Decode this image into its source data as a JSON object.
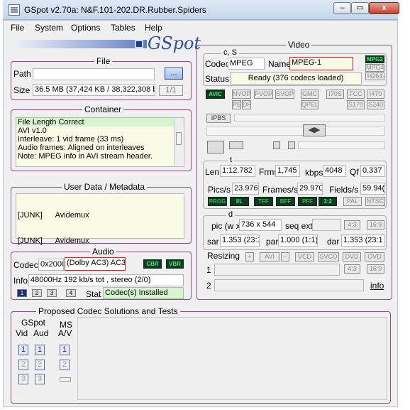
{
  "window": {
    "title": "GSpot v2.70a: N&F.101-202.DR.Rubber.Spiders",
    "min": "–",
    "max": "▭",
    "close": "x"
  },
  "menu": [
    "File",
    "System",
    "Options",
    "Tables",
    "Help"
  ],
  "logo": "GSpot",
  "file": {
    "legend": "File",
    "path_label": "Path",
    "path_value": "",
    "browse": "...",
    "size_label": "Size",
    "size_value": "36.5 MB (37,424 KB / 38,322,308 b",
    "counter": "1/1"
  },
  "container": {
    "legend": "Container",
    "lines": [
      "File Length Correct",
      "AVI v1.0",
      "Interleave: 1 vid frame (33 ms)",
      "Audio frames: Aligned on interleaves",
      "Note: MPEG info in AVI stream header."
    ]
  },
  "userdata": {
    "legend": "User Data / Metadata",
    "lines": [
      "[JUNK]      Avidemux",
      "[JUNK]      Avidemux"
    ]
  },
  "audio": {
    "legend": "Audio",
    "codec_label": "Codec",
    "codec_id": "0x2000",
    "codec_name": "(Dolby AC3) AC3",
    "cbr": "CBR",
    "vbr": "VBR",
    "info_label": "Info",
    "info_value": "48000Hz  192 kb/s tot , stereo (2/0)",
    "streams": [
      "1",
      "2",
      "3",
      "4"
    ],
    "stat_label": "Stat",
    "stat_value": "Codec(s) Installed"
  },
  "proposed": {
    "legend": "Proposed Codec Solutions and Tests",
    "gspot_label": "GSpot",
    "ms_label": "MS",
    "vid": "Vid",
    "aud": "Aud",
    "av": "A/V",
    "nums": [
      "1",
      "2",
      "3"
    ]
  },
  "video": {
    "legend": "Video",
    "cs": {
      "legend": "c, S",
      "codec_label": "Codec",
      "codec_value": "MPEG",
      "name_label": "Name",
      "name_value": "MPEG-1",
      "status_label": "Status",
      "status_value": "Ready (376 codecs loaded)",
      "side": [
        "MPG2",
        "MPG4",
        "H264"
      ]
    },
    "flags_row1": [
      "AVIC",
      "NVOP",
      "PVOP",
      "SVOP",
      "GMC",
      "I70S",
      "FCC",
      "I470"
    ],
    "flags_row2": [
      "PE",
      "DF",
      "QPEL",
      "S170",
      "S240"
    ],
    "ipbs": "IPBS",
    "t": {
      "legend": "t",
      "len_label": "Len",
      "len_value": "1:12.782",
      "frms_label": "Frms",
      "frms_value": "1,745",
      "kbps_label": "kbps",
      "kbps_value": "4048",
      "qf_label": "Qf",
      "qf_value": "0.337",
      "pics_label": "Pics/s",
      "pics_value": "23.976",
      "frames_label": "Frames/s",
      "frames_value": "29.970",
      "fields_label": "Fields/s",
      "fields_value": "59.94(",
      "badges": [
        "PROG",
        "I/L",
        "TFF",
        "BFF",
        "PFF",
        "3:2",
        "PAL",
        "NTSC"
      ]
    },
    "d": {
      "legend": "d",
      "pic_label": "pic (w x",
      "pic_value": "736 x 544",
      "seq_label": "seq ext",
      "aspect1": [
        "4:3",
        "16:9"
      ],
      "sar_label": "sar",
      "sar_value": "1.353 (23:1",
      "par_label": "par",
      "par_value": "1.000 (1:1)",
      "dar_label": "dar",
      "dar_value": "1.353 (23:1",
      "resizing_label": "Resizing",
      "resize_btns": [
        "+",
        "AVI",
        "–",
        "VCD",
        "SVCD",
        "DVD",
        "OVD"
      ],
      "r1": "1",
      "r2": "2",
      "aspect2": [
        "4:3",
        "16:9"
      ],
      "info_link": "info"
    }
  }
}
